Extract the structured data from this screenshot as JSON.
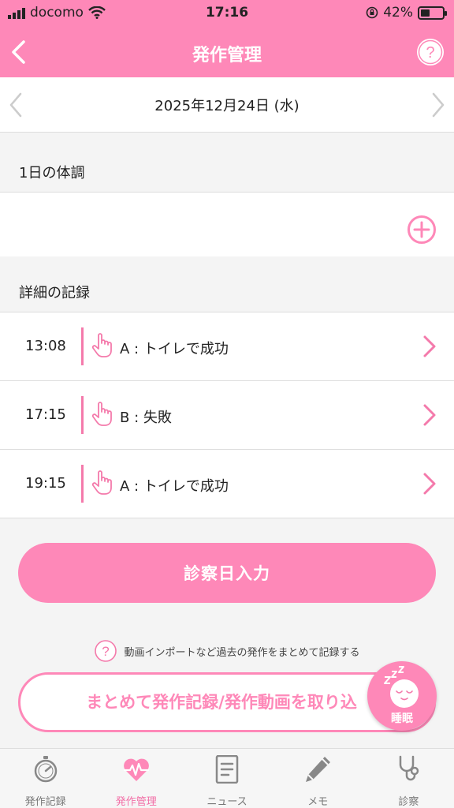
{
  "status": {
    "carrier": "docomo",
    "time": "17:16",
    "battery": "42%",
    "battery_level": 0.42
  },
  "header": {
    "title": "発作管理",
    "help_label": "?"
  },
  "date": {
    "current": "2025年12月24日 (水)"
  },
  "sections": {
    "condition_title": "1日の体調",
    "records_title": "詳細の記録"
  },
  "records": [
    {
      "time": "13:08",
      "label": "A : トイレで成功"
    },
    {
      "time": "17:15",
      "label": "B : 失敗"
    },
    {
      "time": "19:15",
      "label": "A : トイレで成功"
    }
  ],
  "actions": {
    "diagnosis_label": "診察日入力",
    "hint_text": "動画インポートなど過去の発作をまとめて記録する",
    "bulk_label": "まとめて発作記録/発作動画を取り込",
    "sleep_label": "睡眠"
  },
  "tabs": [
    {
      "label": "発作記録",
      "icon": "stopwatch-icon"
    },
    {
      "label": "発作管理",
      "icon": "heart-pulse-icon",
      "active": true
    },
    {
      "label": "ニュース",
      "icon": "document-icon"
    },
    {
      "label": "メモ",
      "icon": "pencil-icon"
    },
    {
      "label": "診察",
      "icon": "stethoscope-icon"
    }
  ],
  "colors": {
    "accent": "#fe88b8",
    "accent_dark": "#f47aab",
    "background": "#f4f4f4"
  }
}
